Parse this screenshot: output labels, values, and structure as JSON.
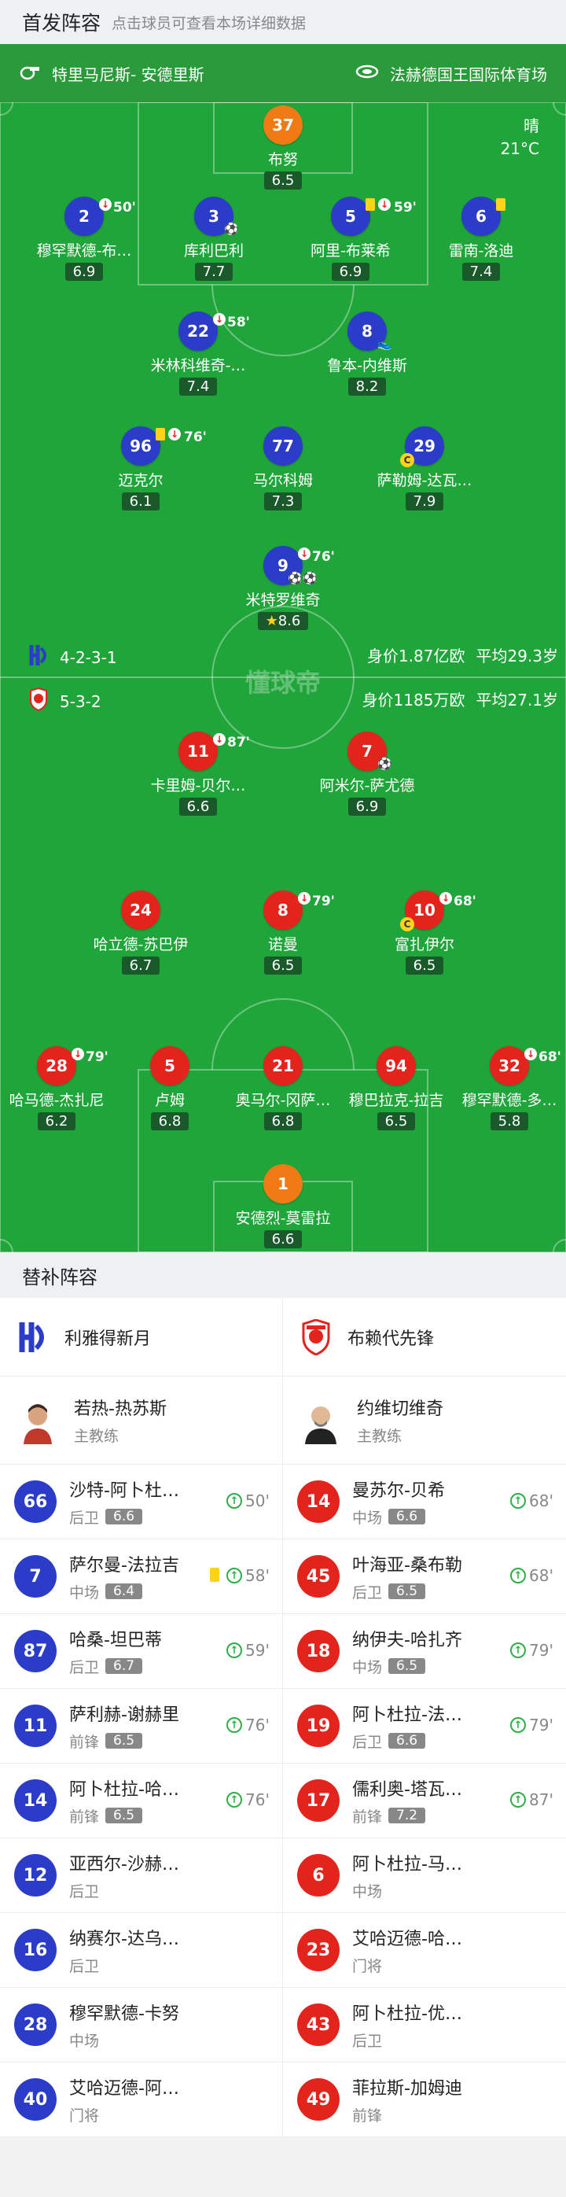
{
  "header": {
    "title": "首发阵容",
    "subtitle": "点击球员可查看本场详细数据"
  },
  "info": {
    "referee": "特里马尼斯- 安德里斯",
    "venue": "法赫德国王国际体育场",
    "weather": "晴",
    "temp": "21°C"
  },
  "home": {
    "formation": "4-2-3-1",
    "value": "身价1.87亿欧",
    "avg_age": "平均29.3岁",
    "name": "利雅得新月",
    "coach": "若热-热苏斯",
    "coach_role": "主教练"
  },
  "away": {
    "formation": "5-3-2",
    "value": "身价1185万欧",
    "avg_age": "平均27.1岁",
    "name": "布赖代先锋",
    "coach": "约维切维奇",
    "coach_role": "主教练"
  },
  "watermark": "懂球帝",
  "lineup_home": [
    {
      "num": "37",
      "name": "布努",
      "rating": "6.5"
    },
    {
      "num": "2",
      "name": "穆罕默德-布…",
      "rating": "6.9",
      "min": "50'"
    },
    {
      "num": "3",
      "name": "库利巴利",
      "rating": "7.7"
    },
    {
      "num": "5",
      "name": "阿里-布莱希",
      "rating": "6.9",
      "min": "59'"
    },
    {
      "num": "6",
      "name": "雷南-洛迪",
      "rating": "7.4"
    },
    {
      "num": "22",
      "name": "米林科维奇-…",
      "rating": "7.4",
      "min": "58'"
    },
    {
      "num": "8",
      "name": "鲁本-内维斯",
      "rating": "8.2"
    },
    {
      "num": "96",
      "name": "迈克尔",
      "rating": "6.1",
      "min": "76'"
    },
    {
      "num": "77",
      "name": "马尔科姆",
      "rating": "7.3"
    },
    {
      "num": "29",
      "name": "萨勒姆-达瓦…",
      "rating": "7.9"
    },
    {
      "num": "9",
      "name": "米特罗维奇",
      "rating": "8.6",
      "min": "76'"
    }
  ],
  "lineup_away": [
    {
      "num": "11",
      "name": "卡里姆-贝尔…",
      "rating": "6.6",
      "min": "87'"
    },
    {
      "num": "7",
      "name": "阿米尔-萨尤德",
      "rating": "6.9"
    },
    {
      "num": "24",
      "name": "哈立德-苏巴伊",
      "rating": "6.7"
    },
    {
      "num": "8",
      "name": "诺曼",
      "rating": "6.5",
      "min": "79'"
    },
    {
      "num": "10",
      "name": "富扎伊尔",
      "rating": "6.5",
      "min": "68'"
    },
    {
      "num": "28",
      "name": "哈马德-杰扎尼",
      "rating": "6.2",
      "min": "79'"
    },
    {
      "num": "5",
      "name": "卢姆",
      "rating": "6.8"
    },
    {
      "num": "21",
      "name": "奥马尔-冈萨…",
      "rating": "6.8"
    },
    {
      "num": "94",
      "name": "穆巴拉克-拉吉",
      "rating": "6.5"
    },
    {
      "num": "32",
      "name": "穆罕默德-多…",
      "rating": "5.8",
      "min": "68'"
    },
    {
      "num": "1",
      "name": "安德烈-莫雷拉",
      "rating": "6.6"
    }
  ],
  "subs_title": "替补阵容",
  "subs_home": [
    {
      "num": "66",
      "name": "沙特-阿卜杜…",
      "pos": "后卫",
      "rating": "6.6",
      "min": "50'"
    },
    {
      "num": "7",
      "name": "萨尔曼-法拉吉",
      "pos": "中场",
      "rating": "6.4",
      "min": "58'"
    },
    {
      "num": "87",
      "name": "哈桑-坦巴蒂",
      "pos": "后卫",
      "rating": "6.7",
      "min": "59'"
    },
    {
      "num": "11",
      "name": "萨利赫-谢赫里",
      "pos": "前锋",
      "rating": "6.5",
      "min": "76'"
    },
    {
      "num": "14",
      "name": "阿卜杜拉-哈…",
      "pos": "前锋",
      "rating": "6.5",
      "min": "76'"
    },
    {
      "num": "12",
      "name": "亚西尔-沙赫…",
      "pos": "后卫"
    },
    {
      "num": "16",
      "name": "纳赛尔-达乌…",
      "pos": "后卫"
    },
    {
      "num": "28",
      "name": "穆罕默德-卡努",
      "pos": "中场"
    },
    {
      "num": "40",
      "name": "艾哈迈德-阿…",
      "pos": "门将"
    }
  ],
  "subs_away": [
    {
      "num": "14",
      "name": "曼苏尔-贝希",
      "pos": "中场",
      "rating": "6.6",
      "min": "68'"
    },
    {
      "num": "45",
      "name": "叶海亚-桑布勒",
      "pos": "后卫",
      "rating": "6.5",
      "min": "68'"
    },
    {
      "num": "18",
      "name": "纳伊夫-哈扎齐",
      "pos": "中场",
      "rating": "6.5",
      "min": "79'"
    },
    {
      "num": "19",
      "name": "阿卜杜拉-法…",
      "pos": "后卫",
      "rating": "6.6",
      "min": "79'"
    },
    {
      "num": "17",
      "name": "儒利奥-塔瓦…",
      "pos": "前锋",
      "rating": "7.2",
      "min": "87'"
    },
    {
      "num": "6",
      "name": "阿卜杜拉-马…",
      "pos": "中场"
    },
    {
      "num": "23",
      "name": "艾哈迈德-哈…",
      "pos": "门将"
    },
    {
      "num": "43",
      "name": "阿卜杜拉-优…",
      "pos": "后卫"
    },
    {
      "num": "49",
      "name": "菲拉斯-加姆迪",
      "pos": "前锋"
    }
  ],
  "colors": {
    "home": "#2a3cc8",
    "away": "#e3241c",
    "gk": "#f07a14",
    "pitch": "#20a53b"
  }
}
